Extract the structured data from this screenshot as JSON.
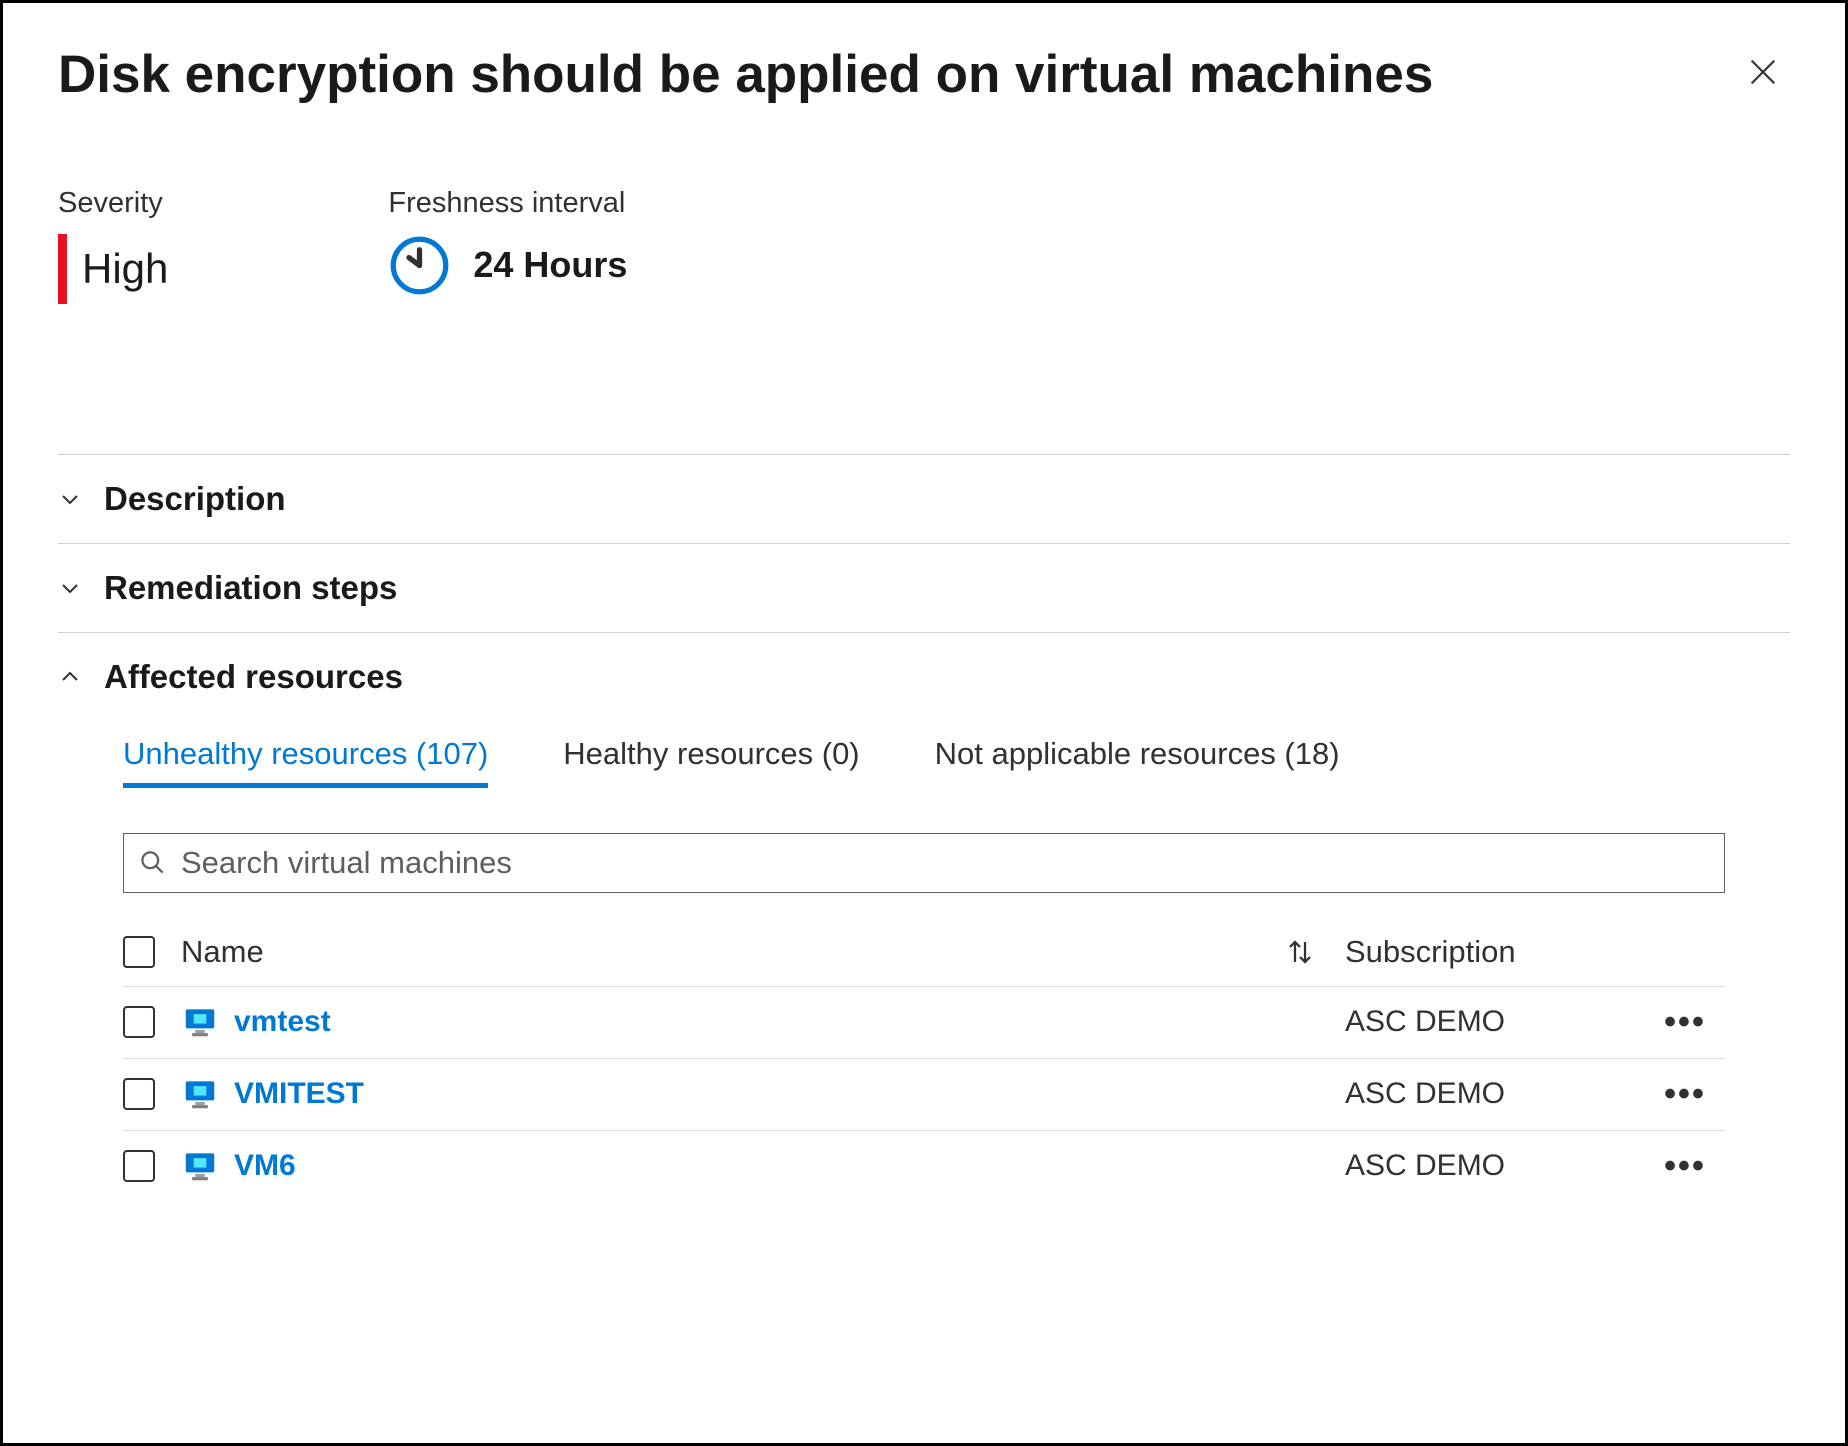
{
  "header": {
    "title": "Disk encryption should be applied on virtual machines"
  },
  "info": {
    "severity_label": "Severity",
    "severity_value": "High",
    "severity_color": "#e81123",
    "freshness_label": "Freshness interval",
    "freshness_value": "24 Hours"
  },
  "sections": {
    "description": {
      "title": "Description",
      "expanded": false
    },
    "remediation": {
      "title": "Remediation steps",
      "expanded": false
    },
    "affected": {
      "title": "Affected resources",
      "expanded": true
    }
  },
  "tabs": {
    "unhealthy": {
      "label": "Unhealthy resources (107)",
      "active": true
    },
    "healthy": {
      "label": "Healthy resources (0)",
      "active": false
    },
    "na": {
      "label": "Not applicable resources (18)",
      "active": false
    }
  },
  "search": {
    "placeholder": "Search virtual machines"
  },
  "table": {
    "columns": {
      "name": "Name",
      "subscription": "Subscription"
    },
    "rows": [
      {
        "name": "vmtest",
        "subscription": "ASC DEMO"
      },
      {
        "name": "VMITEST",
        "subscription": "ASC DEMO"
      },
      {
        "name": "VM6",
        "subscription": "ASC DEMO"
      }
    ]
  }
}
